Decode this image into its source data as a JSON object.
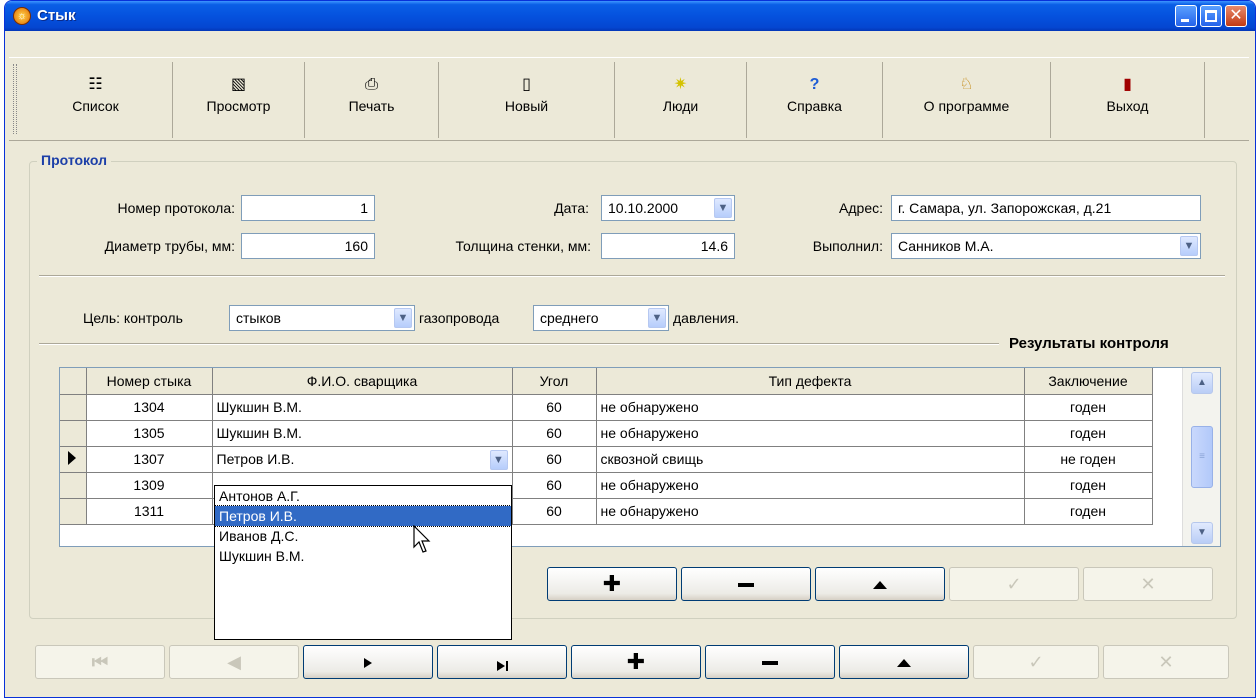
{
  "window": {
    "title": "Стык"
  },
  "toolbar": {
    "items": [
      {
        "label": "Список",
        "icon": "list-icon"
      },
      {
        "label": "Просмотр",
        "icon": "preview-icon"
      },
      {
        "label": "Печать",
        "icon": "printer-icon"
      },
      {
        "label": "Новый",
        "icon": "new-document-icon"
      },
      {
        "label": "Люди",
        "icon": "people-icon"
      },
      {
        "label": "Справка",
        "icon": "help-icon"
      },
      {
        "label": "О программе",
        "icon": "about-icon"
      },
      {
        "label": "Выход",
        "icon": "exit-door-icon"
      }
    ]
  },
  "protocol": {
    "group_title": "Протокол",
    "number_label": "Номер протокола:",
    "number_value": "1",
    "date_label": "Дата:",
    "date_value": "10.10.2000",
    "address_label": "Адрес:",
    "address_value": "г. Самара, ул. Запорожская, д.21",
    "diameter_label": "Диаметр трубы, мм:",
    "diameter_value": "160",
    "wall_label": "Толщина стенки, мм:",
    "wall_value": "14.6",
    "performer_label": "Выполнил:",
    "performer_value": "Санников М.А."
  },
  "goal": {
    "label1": "Цель: контроль",
    "object_value": "стыков",
    "label2": "газопровода",
    "pressure_value": "среднего",
    "label3": "давления."
  },
  "results": {
    "title": "Результаты контроля",
    "columns": [
      "Номер стыка",
      "Ф.И.О. сварщика",
      "Угол",
      "Тип дефекта",
      "Заключение"
    ],
    "rows": [
      {
        "num": "1304",
        "welder": "Шукшин В.М.",
        "angle": "60",
        "defect": "не обнаружено",
        "verdict": "годен"
      },
      {
        "num": "1305",
        "welder": "Шукшин В.М.",
        "angle": "60",
        "defect": "не обнаружено",
        "verdict": "годен"
      },
      {
        "num": "1307",
        "welder": "Петров И.В.",
        "angle": "60",
        "defect": "сквозной свищь",
        "verdict": "не годен"
      },
      {
        "num": "1309",
        "welder": "",
        "angle": "60",
        "defect": "не обнаружено",
        "verdict": "годен"
      },
      {
        "num": "1311",
        "welder": "",
        "angle": "60",
        "defect": "не обнаружено",
        "verdict": "годен"
      }
    ],
    "welder_options": [
      "Антонов А.Г.",
      "Петров И.В.",
      "Иванов Д.С.",
      "Шукшин В.М."
    ],
    "selected_welder": "Петров И.В."
  }
}
